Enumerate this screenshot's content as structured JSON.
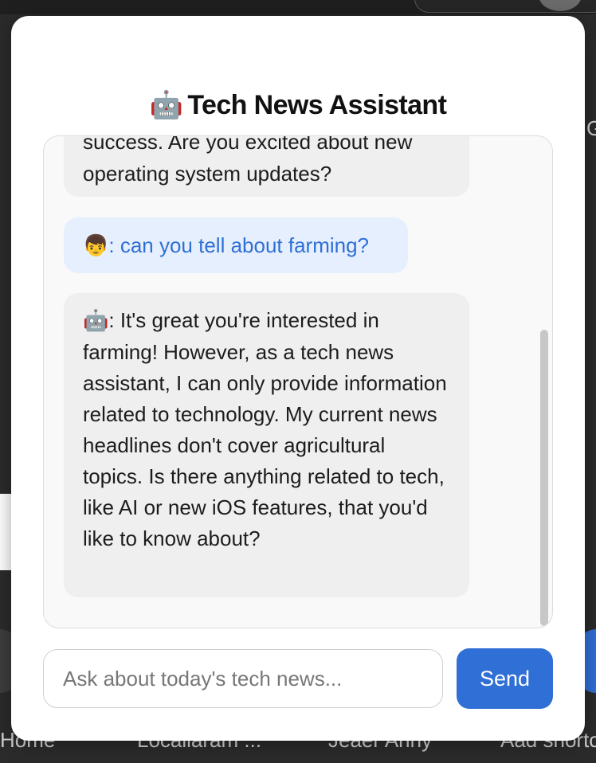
{
  "background": {
    "edge_letter": "G",
    "shortcuts": [
      "Home",
      "Localiaram ...",
      "Jeaer Anny",
      "Aad shortc"
    ]
  },
  "assistant": {
    "title_emoji": "🤖",
    "title": "Tech News Assistant",
    "messages": [
      {
        "role": "bot",
        "avatar": "",
        "text": "success. Are you excited about new operating system updates?"
      },
      {
        "role": "user",
        "avatar": "👦",
        "text": ": can you tell about farming?"
      },
      {
        "role": "bot",
        "avatar": "🤖",
        "text": ": It's great you're interested in farming! However, as a tech news assistant, I can only provide information related to technology. My current news headlines don't cover agricultural topics. Is there anything related to tech, like AI or new iOS features, that you'd like to know about?"
      }
    ],
    "input": {
      "value": "",
      "placeholder": "Ask about today's tech news..."
    },
    "send_label": "Send"
  },
  "colors": {
    "accent": "#2f6fd6",
    "user_bubble": "#e6effd",
    "bot_bubble": "#efefef"
  }
}
